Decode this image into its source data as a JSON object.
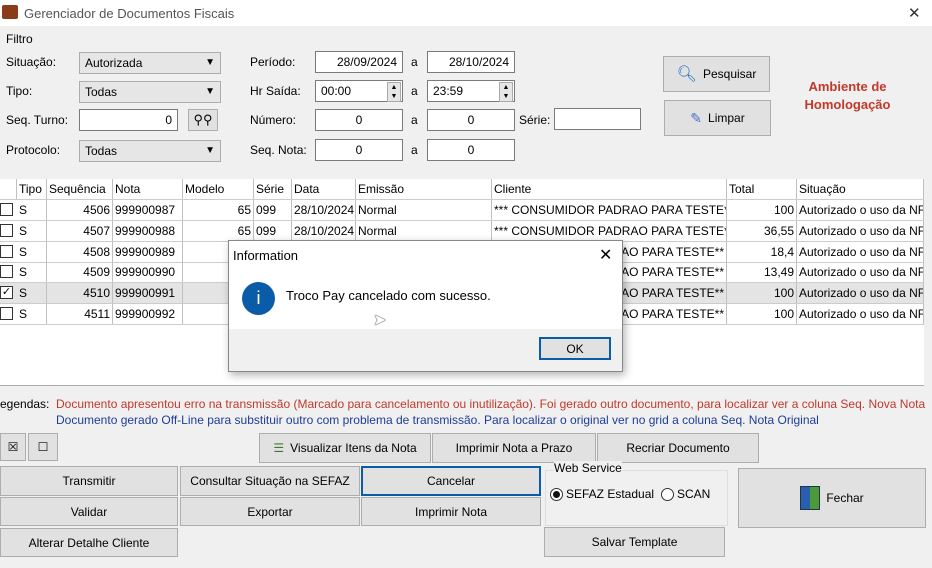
{
  "window": {
    "title": "Gerenciador de Documentos Fiscais",
    "close": "✕"
  },
  "filter": {
    "group": "Filtro",
    "situacao_label": "Situação:",
    "situacao": "Autorizada",
    "tipo_label": "Tipo:",
    "tipo": "Todas",
    "seq_turno_label": "Seq. Turno:",
    "seq_turno": "0",
    "protocolo_label": "Protocolo:",
    "protocolo": "Todas",
    "periodo_label": "Período:",
    "periodo_de": "28/09/2024",
    "periodo_ate": "28/10/2024",
    "a": "a",
    "hr_label": "Hr Saída:",
    "hr_de": "00:00",
    "hr_ate": "23:59",
    "numero_label": "Número:",
    "numero_de": "0",
    "numero_ate": "0",
    "serie_label": "Série:",
    "serie": "",
    "seq_nota_label": "Seq. Nota:",
    "seq_nota_de": "0",
    "seq_nota_ate": "0",
    "pesquisar": "Pesquisar",
    "limpar": "Limpar",
    "ambiente": "Ambiente de Homologação"
  },
  "grid": {
    "columns": [
      "Tipo",
      "Sequência",
      "Nota",
      "Modelo",
      "Série",
      "Data",
      "Emissão",
      "Cliente",
      "Total",
      "Situação"
    ],
    "rows": [
      {
        "checked": false,
        "tipo": "S",
        "seq": "4506",
        "nota": "999900987",
        "modelo": "65",
        "serie": "099",
        "data": "28/10/2024",
        "emissao": "Normal",
        "cliente": "*** CONSUMIDOR PADRAO PARA TESTE**",
        "total": "100",
        "situacao": "Autorizado o uso da NF"
      },
      {
        "checked": false,
        "tipo": "S",
        "seq": "4507",
        "nota": "999900988",
        "modelo": "65",
        "serie": "099",
        "data": "28/10/2024",
        "emissao": "Normal",
        "cliente": "*** CONSUMIDOR PADRAO PARA TESTE**",
        "total": "36,55",
        "situacao": "Autorizado o uso da NF"
      },
      {
        "checked": false,
        "tipo": "S",
        "seq": "4508",
        "nota": "999900989",
        "modelo": "",
        "serie": "",
        "data": "",
        "emissao": "",
        "cliente": "AO PARA TESTE**",
        "total": "18,4",
        "situacao": "Autorizado o uso da NF"
      },
      {
        "checked": false,
        "tipo": "S",
        "seq": "4509",
        "nota": "999900990",
        "modelo": "",
        "serie": "",
        "data": "",
        "emissao": "",
        "cliente": "AO PARA TESTE**",
        "total": "13,49",
        "situacao": "Autorizado o uso da NF"
      },
      {
        "checked": true,
        "tipo": "S",
        "seq": "4510",
        "nota": "999900991",
        "modelo": "",
        "serie": "",
        "data": "",
        "emissao": "",
        "cliente": "AO PARA TESTE**",
        "total": "100",
        "situacao": "Autorizado o uso da NF"
      },
      {
        "checked": false,
        "tipo": "S",
        "seq": "4511",
        "nota": "999900992",
        "modelo": "",
        "serie": "",
        "data": "",
        "emissao": "",
        "cliente": "AO PARA TESTE**",
        "total": "100",
        "situacao": "Autorizado o uso da NF"
      }
    ]
  },
  "legend": {
    "label": "egendas:",
    "red": "Documento apresentou erro na transmissão (Marcado para cancelamento ou inutilização). Foi gerado outro documento, para localizar ver a coluna Seq. Nova Nota",
    "blue": "Documento gerado Off-Line para substituir outro com problema  de transmissão. Para localizar o original ver no grid a coluna Seq. Nota Original"
  },
  "buttons": {
    "check_all": "☒",
    "uncheck_all": "☐",
    "visualizar": "Visualizar Itens da Nota",
    "imprimir_prazo": "Imprimir Nota a Prazo",
    "recriar": "Recriar Documento",
    "transmitir": "Transmitir",
    "consultar": "Consultar Situação na SEFAZ",
    "cancelar": "Cancelar",
    "validar": "Validar",
    "exportar": "Exportar",
    "imprimir": "Imprimir Nota",
    "alterar": "Alterar Detalhe Cliente",
    "salvar": "Salvar Template",
    "fechar": "Fechar"
  },
  "webservice": {
    "label": "Web Service",
    "sefaz": "SEFAZ Estadual",
    "scan": "SCAN",
    "selected": "SEFAZ Estadual"
  },
  "dialog": {
    "title": "Information",
    "message": "Troco Pay cancelado com sucesso.",
    "ok": "OK",
    "close": "✕",
    "icon": "i"
  },
  "colors": {
    "accent": "#0b5ca8",
    "red": "#c0392b",
    "blue": "#1f3c99"
  }
}
